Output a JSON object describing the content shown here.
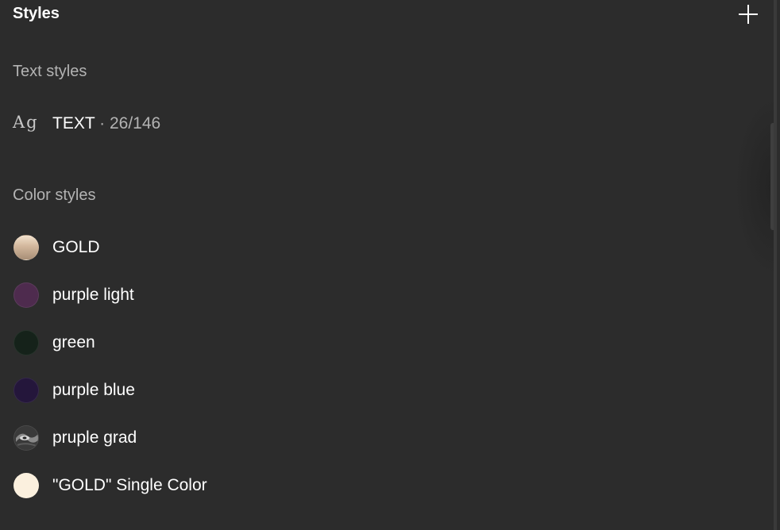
{
  "header": {
    "title": "Styles",
    "add_icon": "plus-icon"
  },
  "text_styles": {
    "section_title": "Text styles",
    "items": [
      {
        "icon": "Ag",
        "name": "TEXT",
        "meta": " · 26/146"
      }
    ]
  },
  "color_styles": {
    "section_title": "Color styles",
    "items": [
      {
        "name": "GOLD",
        "swatch": "gradient-gold",
        "color": "#cdb49a"
      },
      {
        "name": "purple light",
        "swatch": "solid",
        "color": "#4e2b4e"
      },
      {
        "name": "green",
        "swatch": "solid",
        "color": "#15221a"
      },
      {
        "name": "purple blue",
        "swatch": "solid",
        "color": "#24163b"
      },
      {
        "name": "pruple grad",
        "swatch": "gradient-image",
        "color": "#3b3b3b"
      },
      {
        "name": "\"GOLD\" Single Color",
        "swatch": "solid",
        "color": "#fbf0de"
      }
    ]
  }
}
